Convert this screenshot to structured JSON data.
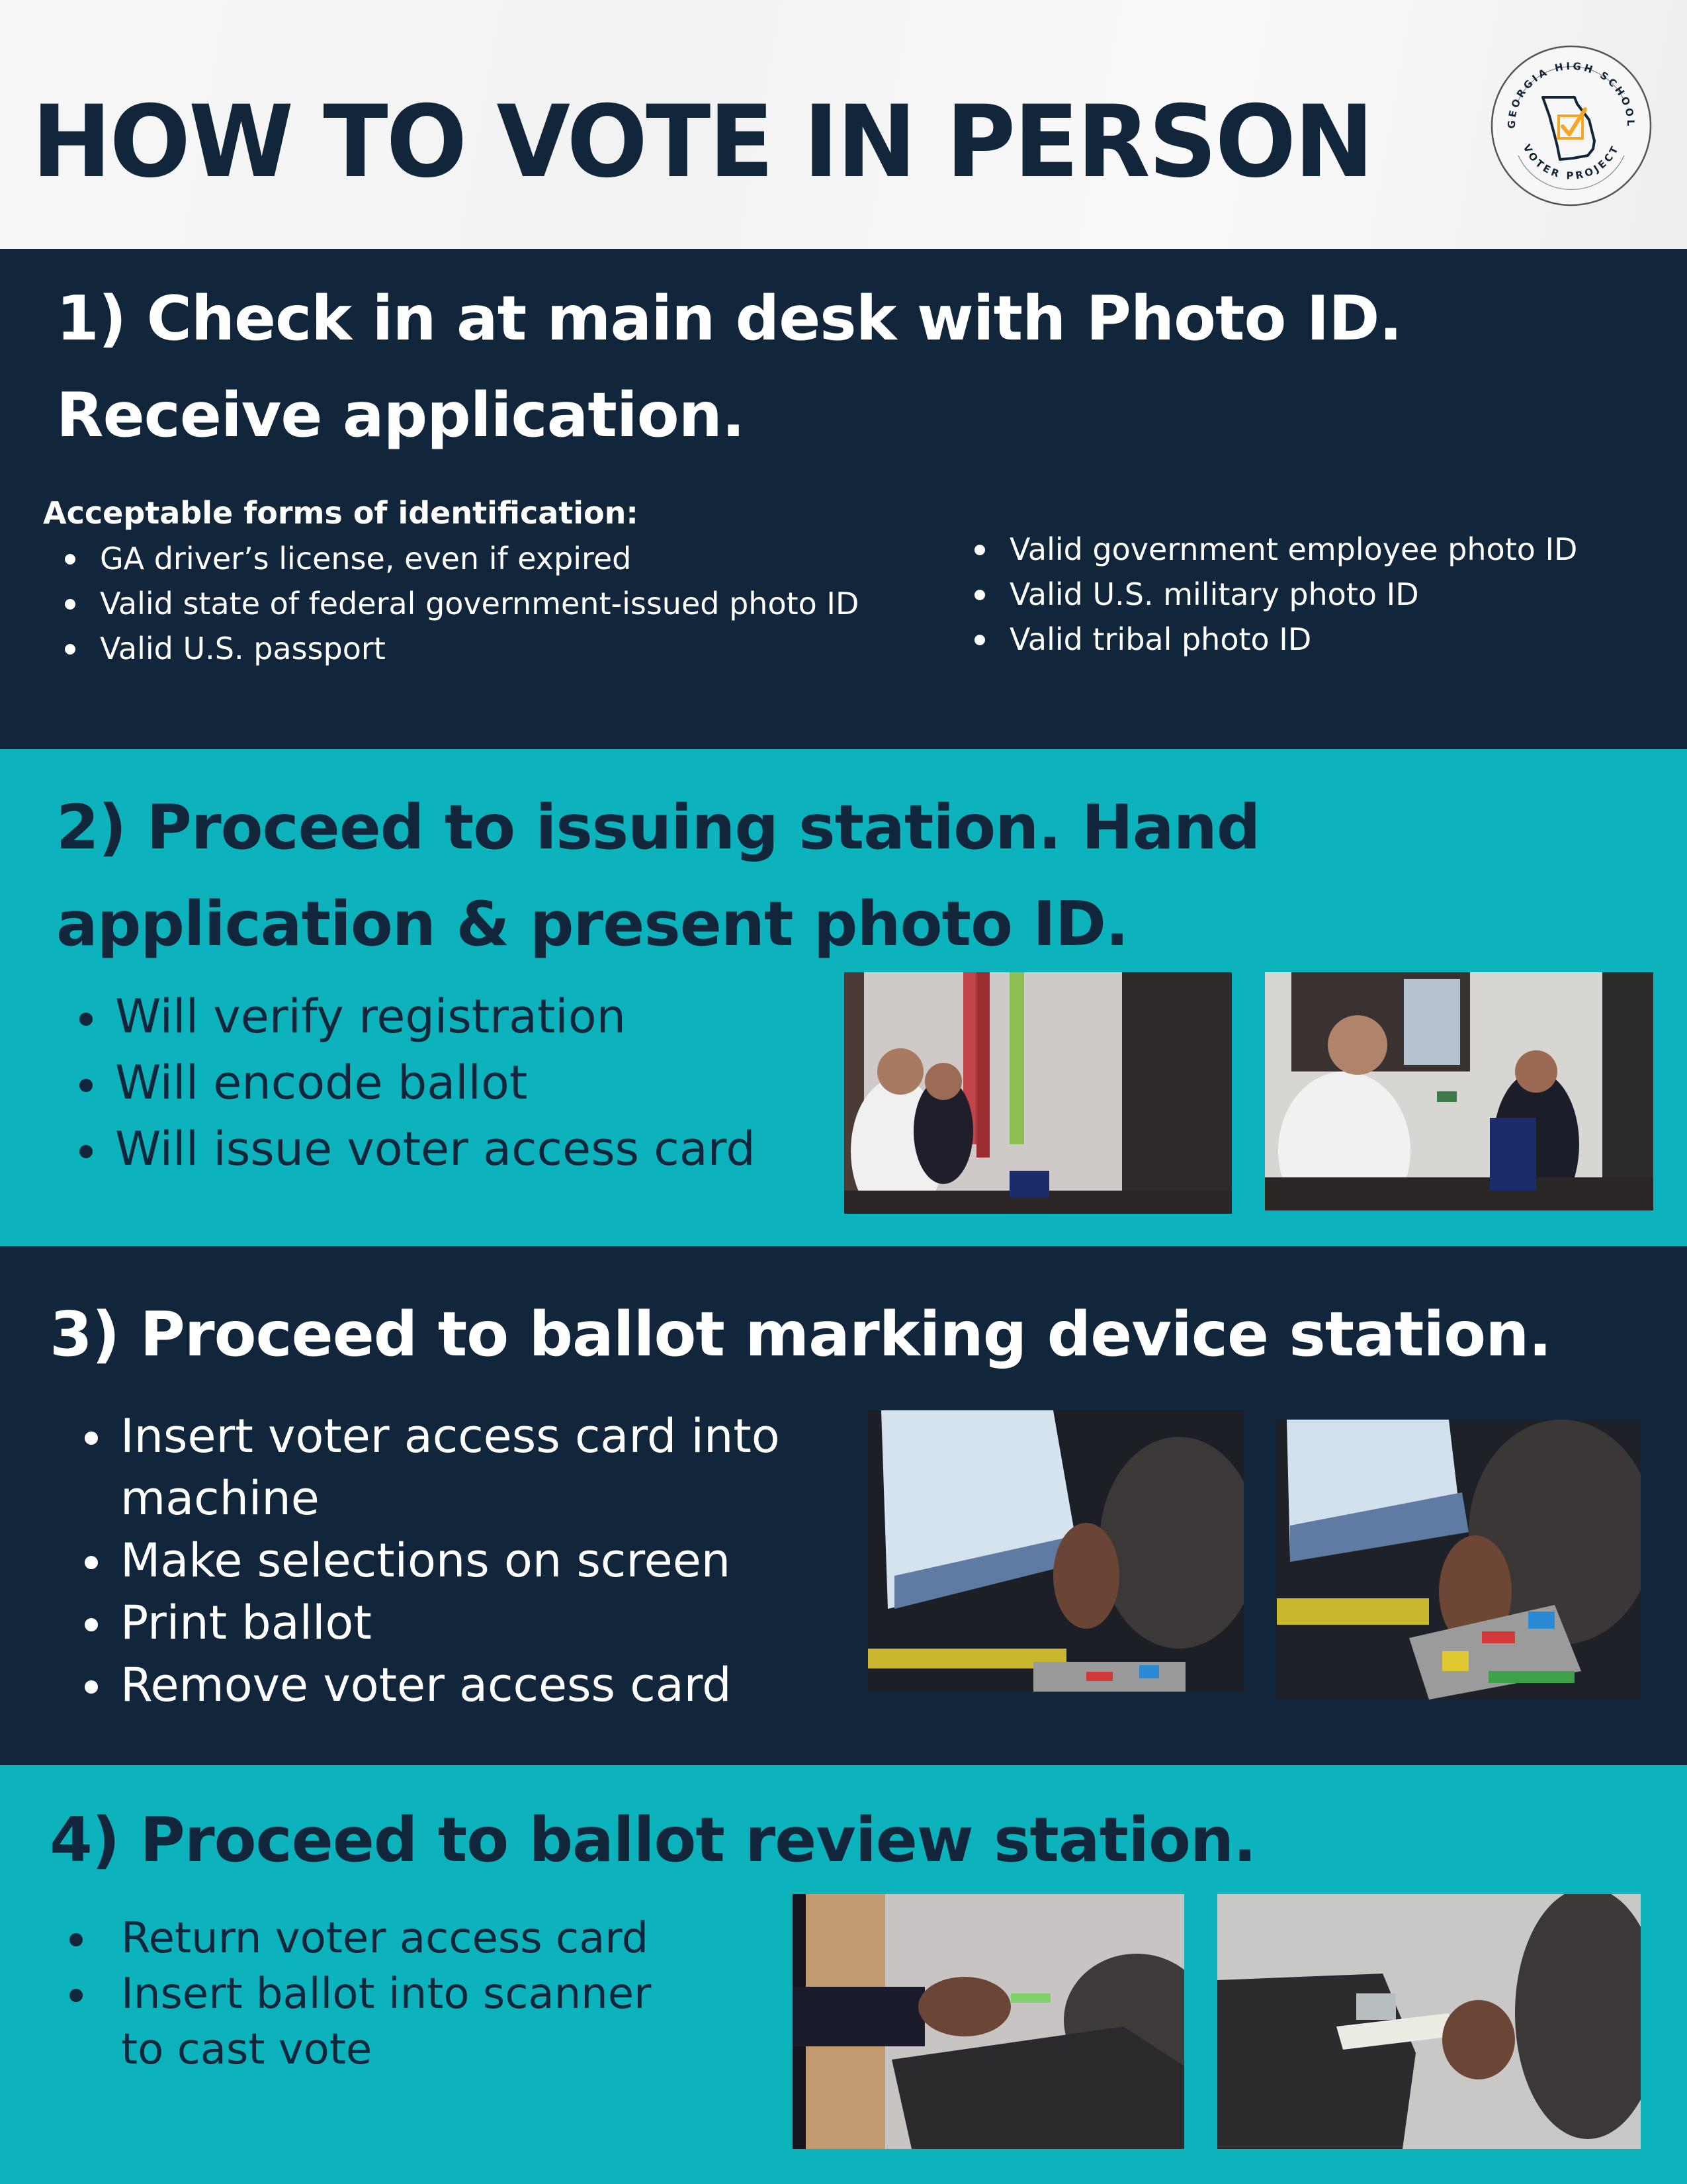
{
  "header": {
    "title": "HOW TO VOTE IN PERSON",
    "logo": {
      "top_text": "GEORGIA HIGH SCHOOL",
      "bottom_text": "VOTER PROJECT",
      "icon": "georgia-state-checkbox-icon"
    }
  },
  "colors": {
    "navy": "#12263b",
    "teal": "#0cb3bc",
    "white": "#ffffff",
    "logo_accent": "#f5a623"
  },
  "steps": [
    {
      "title_line1": "1) Check in at main desk with Photo ID.",
      "title_line2": "Receive application.",
      "subheading": "Acceptable forms of identification:",
      "list_left": [
        "GA driver’s license, even if expired",
        "Valid state of federal government-issued photo ID",
        "Valid U.S. passport"
      ],
      "list_right": [
        "Valid government employee photo ID",
        "Valid U.S. military photo ID",
        "Valid tribal photo ID"
      ]
    },
    {
      "title_line1": "2) Proceed to issuing station. Hand",
      "title_line2": "application & present photo ID.",
      "items": [
        "Will verify registration",
        "Will encode ballot",
        "Will issue voter access card"
      ],
      "photos": [
        "Poll workers at desk receiving application from voter",
        "Poll worker handing voter access card"
      ]
    },
    {
      "title": "3) Proceed to ballot marking device station.",
      "items": [
        "Insert voter access card into",
        "machine",
        "Make selections on screen",
        "Print ballot",
        "Remove voter access card"
      ],
      "photos": [
        "Voter pressing Print Ballot on touchscreen",
        "Voter inserting card into card reader"
      ]
    },
    {
      "title": "4) Proceed to ballot review station.",
      "items": [
        "Return voter access card",
        "Insert ballot into scanner",
        "to cast vote"
      ],
      "photos": [
        "Voter returning access card",
        "Voter inserting ballot into scanner"
      ]
    }
  ]
}
